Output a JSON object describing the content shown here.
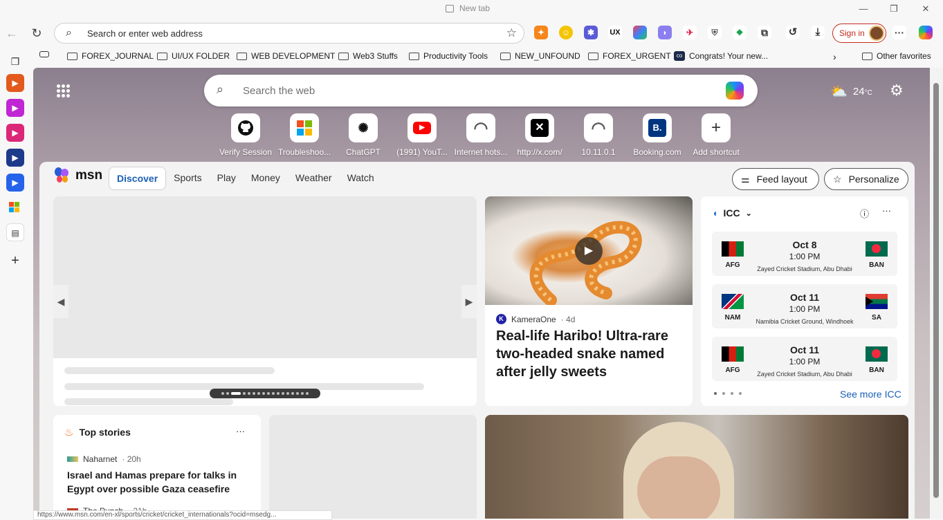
{
  "window": {
    "tab_title": "New tab",
    "minimize": "—",
    "restore": "❐",
    "close": "✕"
  },
  "toolbar": {
    "back_icon": "←",
    "refresh_icon": "↻",
    "address_placeholder": "Search or enter web address",
    "signin_label": "Sign in",
    "extensions": [
      "metamask-fox-icon",
      "smiley-extension-icon",
      "blue-extension-icon",
      "ux-extension-icon",
      "colorful-extension-icon",
      "purple-extension-icon",
      "red-extension-icon",
      "shield-extension-icon",
      "green-extension-icon",
      "puzzle-extensions-icon",
      "history-icon",
      "download-icon"
    ]
  },
  "favorites": {
    "items": [
      "FOREX_JOURNAL",
      "UI/UX FOLDER",
      "WEB DEVELOPMENT",
      "Web3 Stuffs",
      "Productivity Tools",
      "NEW_UNFOUND",
      "FOREX_URGENT",
      "Congrats! Your new..."
    ],
    "other": "Other favorites"
  },
  "newtab": {
    "search_placeholder": "Search the web",
    "weather_temp": "24",
    "weather_unit": "°C",
    "shortcuts": [
      {
        "label": "Verify Session",
        "icon": "github-icon",
        "glyph": "◉",
        "color": "#111111"
      },
      {
        "label": "Troubleshoo...",
        "icon": "microsoft-icon",
        "glyph": "",
        "color": "#f25022"
      },
      {
        "label": "ChatGPT",
        "icon": "chatgpt-icon",
        "glyph": "✺",
        "color": "#111111"
      },
      {
        "label": "(1991) YouT...",
        "icon": "youtube-icon",
        "glyph": "▶",
        "color": "#ff0000"
      },
      {
        "label": "Internet hots...",
        "icon": "router-icon",
        "glyph": "◠",
        "color": "#555555"
      },
      {
        "label": "http://x.com/",
        "icon": "x-icon",
        "glyph": "𝕏",
        "color": "#000000"
      },
      {
        "label": "10.11.0.1",
        "icon": "router-icon",
        "glyph": "◠",
        "color": "#555555"
      },
      {
        "label": "Booking.com",
        "icon": "booking-icon",
        "glyph": "B.",
        "color": "#003580"
      },
      {
        "label": "Add shortcut",
        "icon": "plus-icon",
        "glyph": "+",
        "color": "#333333"
      }
    ]
  },
  "feed": {
    "brand": "msn",
    "tabs": [
      "Discover",
      "Sports",
      "Play",
      "Money",
      "Weather",
      "Watch"
    ],
    "feed_layout": "Feed layout",
    "personalize": "Personalize",
    "video_card": {
      "source": "KameraOne",
      "source_initial": "K",
      "age": "· 4d",
      "title": "Real-life Haribo! Ultra-rare two-headed snake named after jelly sweets"
    },
    "icc": {
      "title": "ICC",
      "see_more": "See more ICC",
      "matches": [
        {
          "date": "Oct 8",
          "time": "1:00 PM",
          "venue": "Zayed Cricket Stadium, Abu Dhabi",
          "home": "AFG",
          "away": "BAN"
        },
        {
          "date": "Oct 11",
          "time": "1:00 PM",
          "venue": "Namibia Cricket Ground, Windhoek",
          "home": "NAM",
          "away": "SA"
        },
        {
          "date": "Oct 11",
          "time": "1:00 PM",
          "venue": "Zayed Cricket Stadium, Abu Dhabi",
          "home": "AFG",
          "away": "BAN"
        }
      ]
    },
    "top_stories": {
      "title": "Top stories",
      "items": [
        {
          "source": "Naharnet",
          "age": "· 20h",
          "title": "Israel and Hamas prepare for talks in Egypt over possible Gaza ceasefire"
        },
        {
          "source": "The Punch",
          "age": "· 21h",
          "title": ""
        }
      ]
    },
    "more_icon": "···"
  },
  "status_url": "https://www.msn.com/en-xl/sports/cricket/cricket_internationals?ocid=msedg..."
}
